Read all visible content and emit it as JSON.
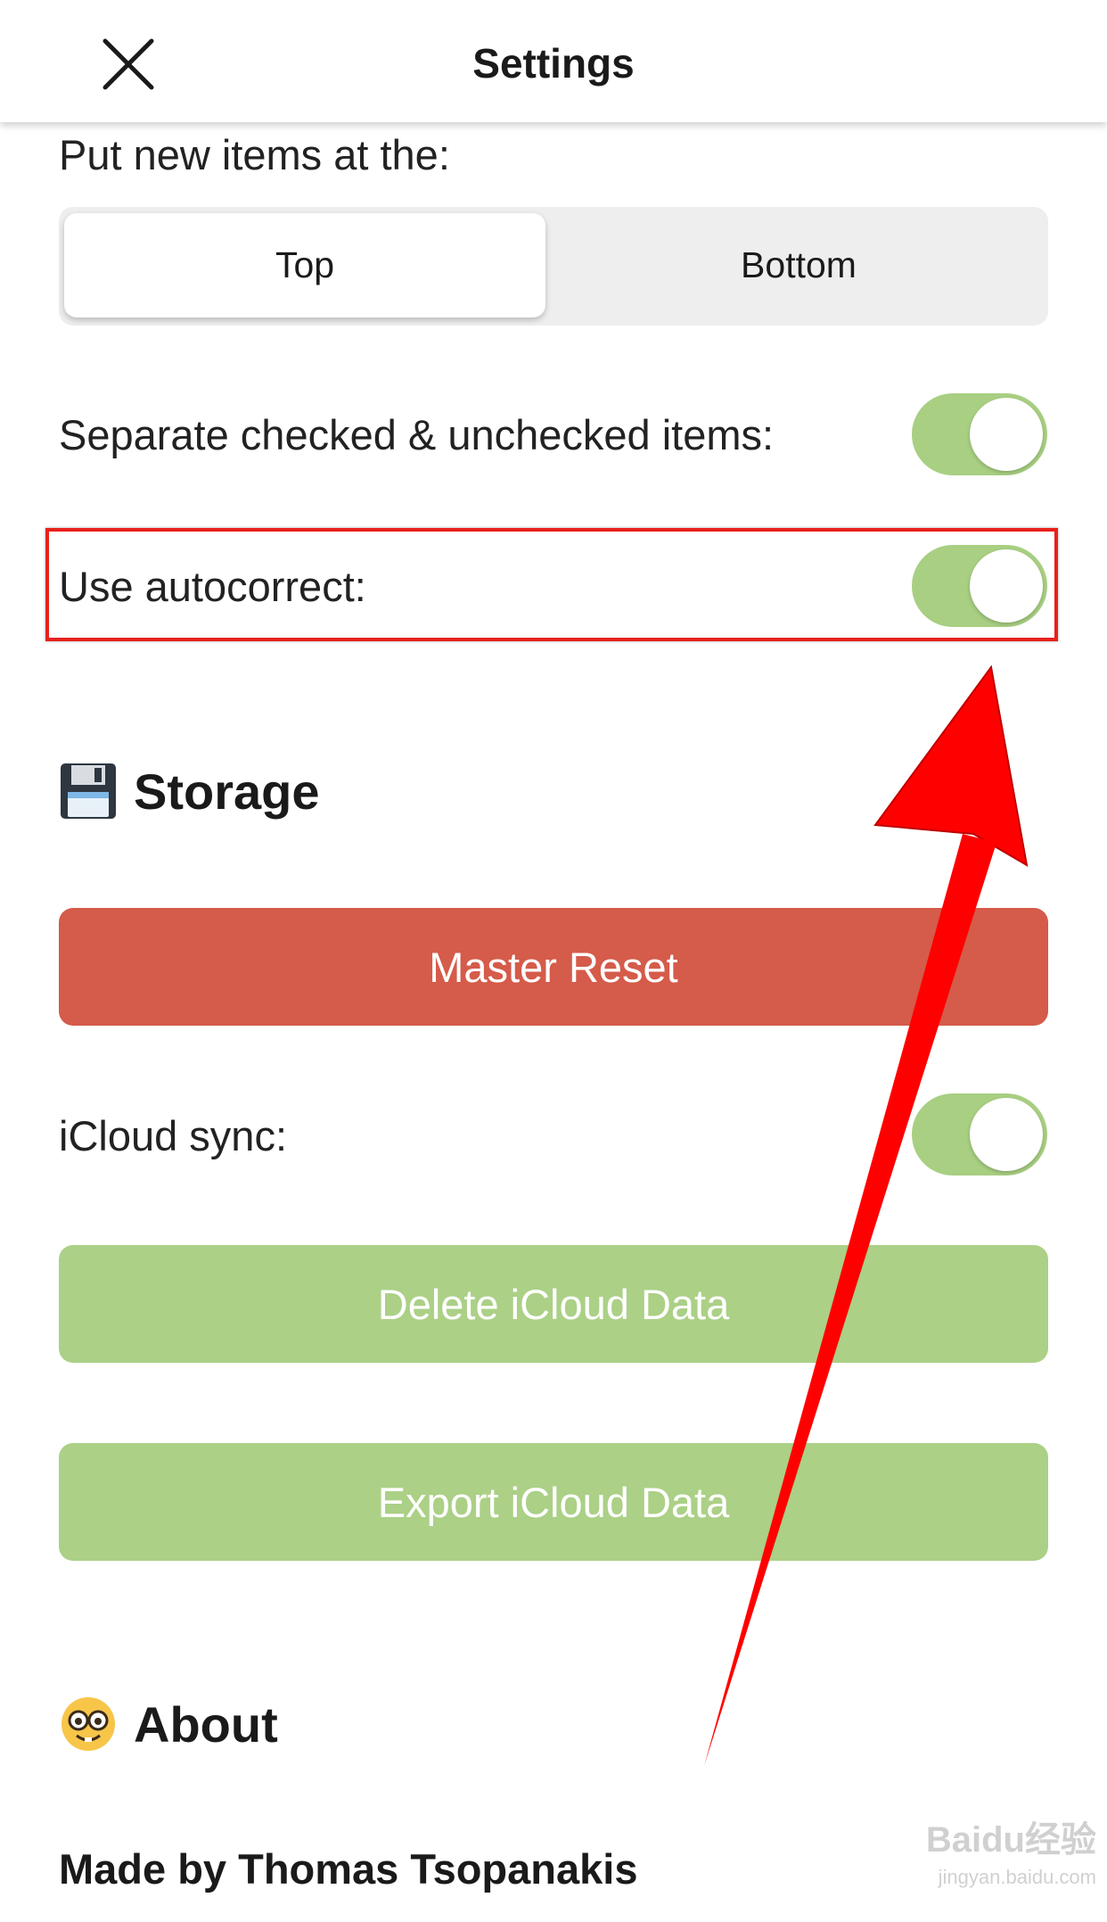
{
  "header": {
    "title": "Settings"
  },
  "new_items": {
    "label": "Put new items at the:",
    "options": [
      "Top",
      "Bottom"
    ],
    "selected": "Top"
  },
  "separate": {
    "label": "Separate checked & unchecked items:",
    "enabled": true
  },
  "autocorrect": {
    "label": "Use autocorrect:",
    "enabled": true
  },
  "storage": {
    "title": "Storage",
    "icon": "floppy-disk-icon",
    "master_reset": "Master Reset",
    "icloud_label": "iCloud sync:",
    "icloud_enabled": true,
    "delete_label": "Delete iCloud Data",
    "export_label": "Export iCloud Data"
  },
  "about": {
    "title": "About",
    "icon": "nerd-face-icon",
    "made_by": "Made by Thomas Tsopanakis"
  },
  "watermark": {
    "main": "Baidu经验",
    "sub": "jingyan.baidu.com"
  },
  "colors": {
    "toggle_on": "#a8cf82",
    "danger": "#d55b4a",
    "green_button": "#abd086",
    "highlight": "#e8201c"
  }
}
